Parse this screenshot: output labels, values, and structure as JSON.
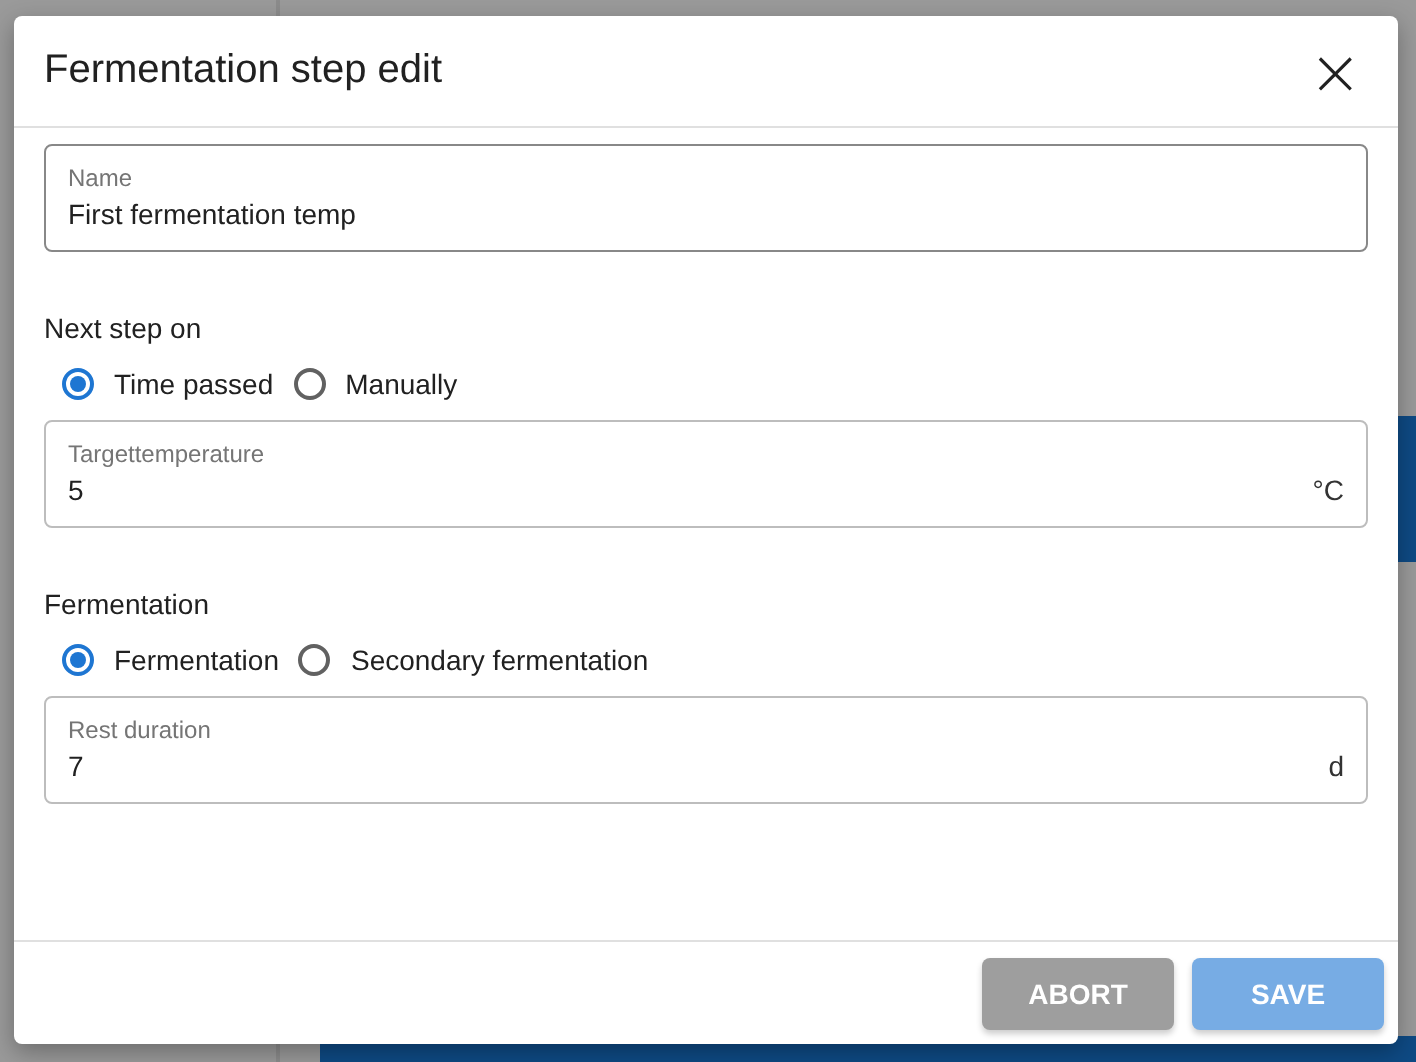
{
  "dialog": {
    "title": "Fermentation step edit",
    "close_glyph": "×"
  },
  "sections": [
    {
      "kind": "field",
      "label": "Name",
      "value": "First fermentation temp"
    },
    {
      "kind": "radio_group",
      "label": "Next step on",
      "options": [
        {
          "label": "Time passed",
          "selected": true
        },
        {
          "label": "Manually",
          "selected": false
        }
      ]
    },
    {
      "kind": "field",
      "label": "Targettemperature",
      "value": "5",
      "unit": "°C"
    },
    {
      "kind": "radio_group",
      "label": "Fermentation",
      "options": [
        {
          "label": "Fermentation",
          "selected": true
        },
        {
          "label": "Secondary fermentation",
          "selected": false
        }
      ]
    },
    {
      "kind": "field",
      "label": "Rest duration",
      "value": "7",
      "unit": "d"
    }
  ],
  "buttons": [
    {
      "label": "ABORT",
      "kind": "secondary"
    },
    {
      "label": "SAVE",
      "kind": "primary"
    }
  ]
}
